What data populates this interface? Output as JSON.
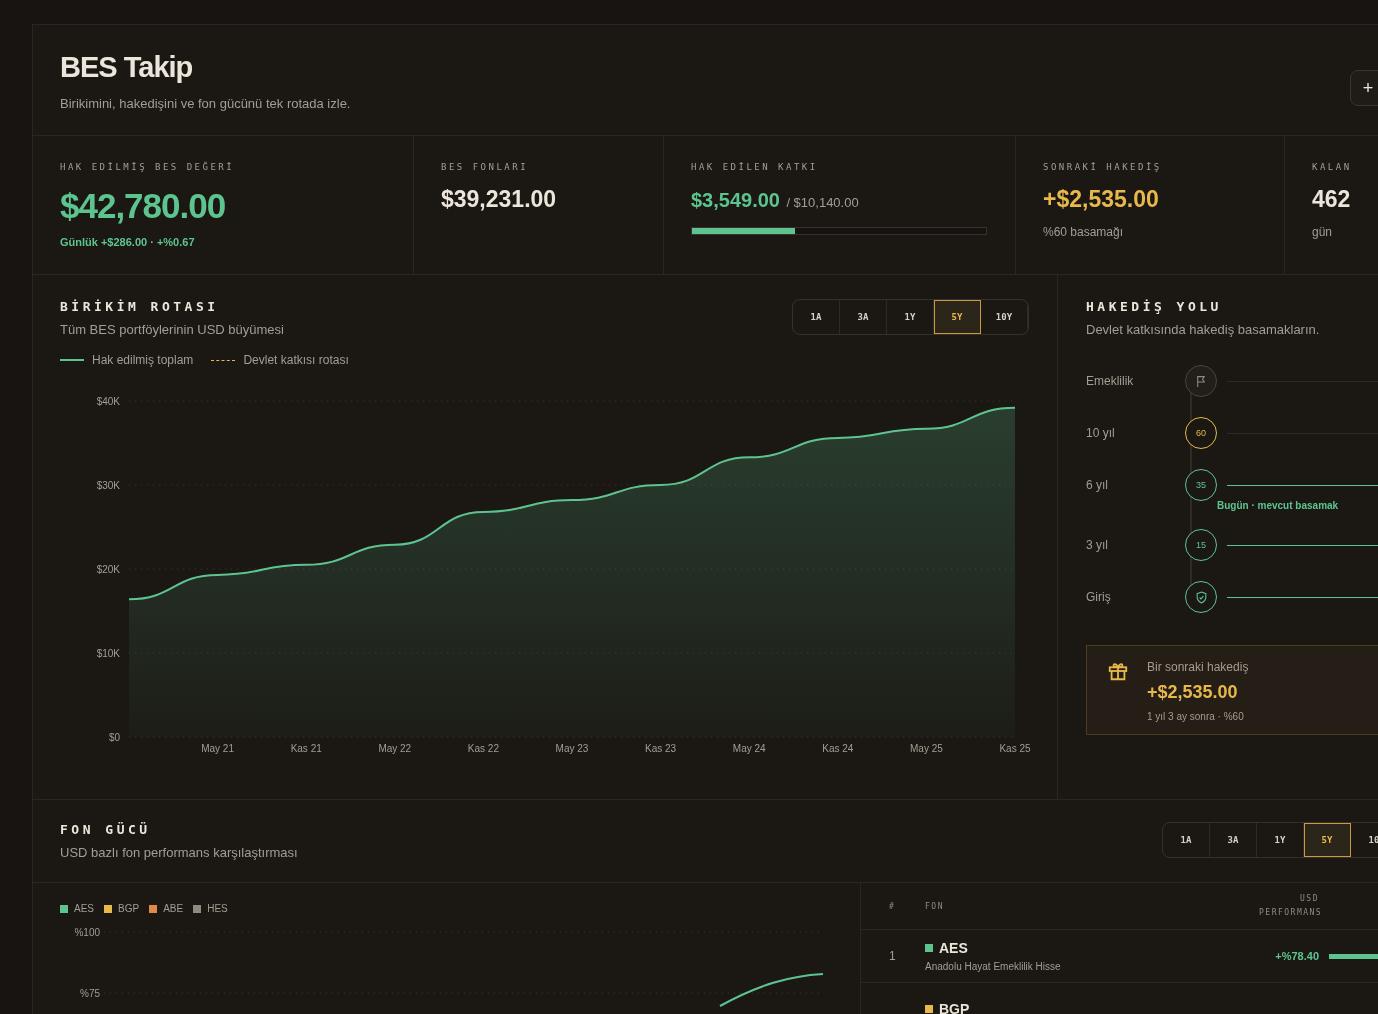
{
  "header": {
    "title": "BES Takip",
    "subtitle": "Birikimini, hakedişini ve fon gücünü tek rotada izle.",
    "action": "+"
  },
  "kpis": [
    {
      "kind": "hero",
      "label": "HAK EDİLMİŞ BES DEĞERİ",
      "value": "$42,780.00",
      "note": "Günlük +$286.00 · +%0.67"
    },
    {
      "kind": "plain",
      "label": "BES FONLARI",
      "value": "$39,231.00"
    },
    {
      "kind": "progress",
      "label": "HAK EDİLEN KATKI",
      "value": "$3,549.00",
      "total": "/ $10,140.00",
      "level": 0.35
    },
    {
      "kind": "next",
      "label": "SONRAKİ HAKEDİŞ",
      "value": "+$2,535.00",
      "note": "%60 basamağı"
    },
    {
      "kind": "plain",
      "label": "KALAN",
      "value": "462",
      "note": "gün"
    }
  ],
  "growth": {
    "title": "BİRİKİM ROTASI",
    "subtitle": "Tüm BES portföylerinin USD büyümesi",
    "ranges": [
      {
        "label": "1A",
        "selected": false
      },
      {
        "label": "3A",
        "selected": false
      },
      {
        "label": "1Y",
        "selected": false
      },
      {
        "label": "5Y",
        "selected": true
      },
      {
        "label": "10Y",
        "selected": false
      }
    ],
    "legend_extra": [
      {
        "label": "Devlet katkısı rotası",
        "color": "#e8b84a"
      }
    ],
    "chart_data": {
      "type": "area",
      "grid": true,
      "categories": [
        null,
        "May 21",
        "Kas 21",
        "May 22",
        "Kas 22",
        "May 23",
        "Kas 23",
        "May 24",
        "Kas 24",
        "May 25",
        "Kas 25"
      ],
      "series": [
        {
          "name": "Hak edilmiş toplam",
          "color": "#5dc48f",
          "values": [
            16.4,
            19.3,
            20.5,
            22.9,
            26.8,
            28.2,
            30.0,
            33.3,
            35.6,
            36.7,
            39.2
          ]
        }
      ],
      "ylim": [
        0,
        40
      ],
      "yticks": [
        {
          "value": 0,
          "label": "$0"
        },
        {
          "value": 10,
          "label": "$10K"
        },
        {
          "value": 20,
          "label": "$20K"
        },
        {
          "value": 30,
          "label": "$30K"
        },
        {
          "value": 40,
          "label": "$40K"
        }
      ]
    }
  },
  "vesting": {
    "title": "HAKEDİŞ YOLU",
    "subtitle": "Devlet katkısında hakediş basamakların.",
    "steps": [
      {
        "label": "Emeklilik",
        "kind": "flag",
        "reached": false,
        "next": false
      },
      {
        "label": "10 yıl",
        "kind": "number",
        "mark": "60",
        "reached": false,
        "next": true
      },
      {
        "label": "6 yıl",
        "kind": "number",
        "mark": "35",
        "reached": true,
        "next": false,
        "note": "Bugün · mevcut basamak"
      },
      {
        "label": "3 yıl",
        "kind": "number",
        "mark": "15",
        "reached": true,
        "next": false
      },
      {
        "label": "Giriş",
        "kind": "shield",
        "reached": true,
        "next": false
      }
    ],
    "next": {
      "label": "Bir sonraki hakediş",
      "value": "+$2,535.00",
      "note": "1 yıl 3 ay sonra · %60"
    }
  },
  "funds": {
    "title": "FON GÜCÜ",
    "subtitle": "USD bazlı fon performans karşılaştırması",
    "ranges": [
      {
        "label": "1A",
        "selected": false
      },
      {
        "label": "3A",
        "selected": false
      },
      {
        "label": "1Y",
        "selected": false
      },
      {
        "label": "5Y",
        "selected": true
      },
      {
        "label": "10",
        "selected": false
      }
    ],
    "legend": [
      {
        "label": "AES",
        "color": "#5dc48f"
      },
      {
        "label": "BGP",
        "color": "#e8b84a"
      },
      {
        "label": "ABE",
        "color": "#e0884a"
      },
      {
        "label": "HES",
        "color": "#8f8a80"
      }
    ],
    "axis_labels": [
      "%100",
      "%75"
    ],
    "table": {
      "columns": [
        "#",
        "FON",
        "USD PERFORMANS"
      ],
      "rows": [
        {
          "rank": "1",
          "code": "AES",
          "name": "Anadolu Hayat Emeklilik Hisse",
          "color": "#5dc48f",
          "perf": "+%78.40",
          "level": 1
        },
        {
          "code": "BGP",
          "color": "#e8b84a"
        }
      ]
    }
  }
}
